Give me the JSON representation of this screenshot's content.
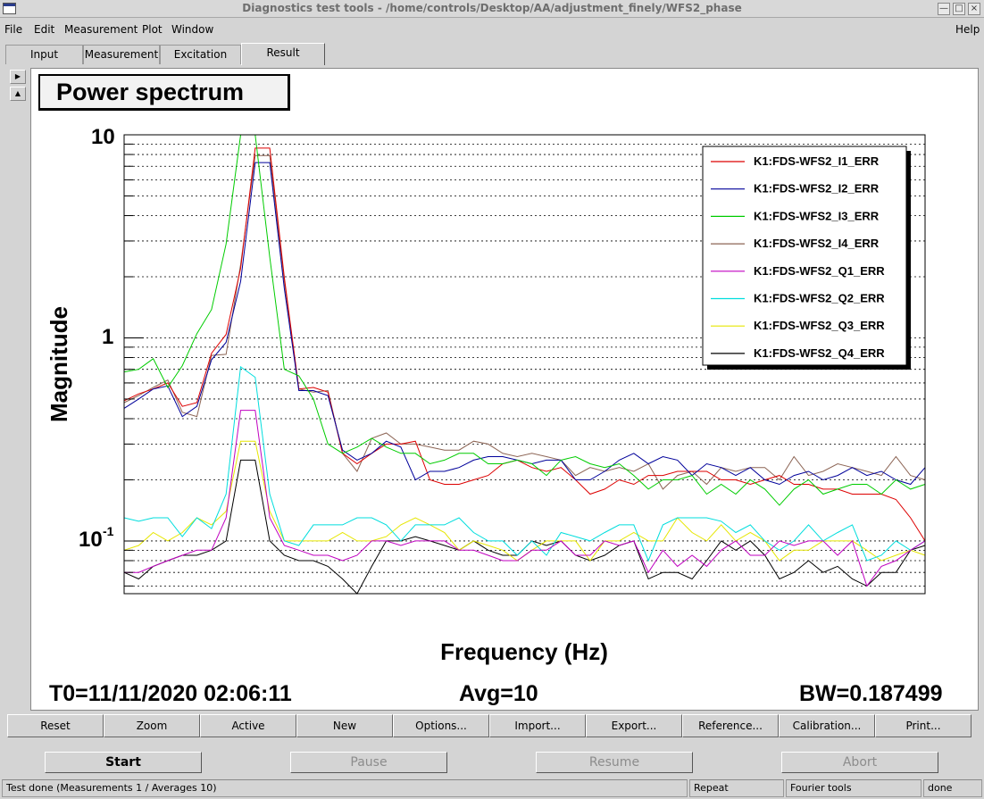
{
  "window": {
    "title": "Diagnostics test tools - /home/controls/Desktop/AA/adjustment_finely/WFS2_phase"
  },
  "menu": {
    "file": "File",
    "edit": "Edit",
    "measurement": "Measurement",
    "plot": "Plot",
    "window": "Window",
    "help": "Help"
  },
  "tabs": {
    "input": "Input",
    "measurement": "Measurement",
    "excitation": "Excitation",
    "result": "Result"
  },
  "plot": {
    "title": "Power spectrum",
    "footer": {
      "t0": "T0=11/11/2020 02:06:11",
      "avg": "Avg=10",
      "bw": "BW=0.187499"
    }
  },
  "chart_data": {
    "type": "line",
    "title": "Power spectrum",
    "xlabel": "Frequency (Hz)",
    "ylabel": "Magnitude",
    "yscale": "log",
    "ylim": [
      0.055,
      10
    ],
    "ytick_labels": {
      "top": "10",
      "mid": "1",
      "exp_base": "10",
      "exp_sup": "-1"
    },
    "grid": true,
    "legend_position": "top-right",
    "colors": {
      "I1": "#dd0000",
      "I2": "#00009a",
      "I3": "#00cc00",
      "I4": "#8c6454",
      "Q1": "#c000c0",
      "Q2": "#00dddd",
      "Q3": "#e6e600",
      "Q4": "#000000"
    },
    "series": [
      {
        "key": "I1",
        "name": "K1:FDS-WFS2_I1_ERR",
        "values": [
          0.49,
          0.53,
          0.56,
          0.6,
          0.46,
          0.48,
          0.84,
          1.04,
          2.2,
          8.6,
          8.6,
          1.99,
          0.56,
          0.57,
          0.54,
          0.27,
          0.24,
          0.27,
          0.3,
          0.3,
          0.31,
          0.2,
          0.19,
          0.19,
          0.2,
          0.21,
          0.24,
          0.25,
          0.23,
          0.22,
          0.23,
          0.2,
          0.17,
          0.18,
          0.2,
          0.19,
          0.21,
          0.21,
          0.22,
          0.22,
          0.22,
          0.2,
          0.2,
          0.19,
          0.2,
          0.21,
          0.19,
          0.19,
          0.18,
          0.18,
          0.17,
          0.17,
          0.17,
          0.16,
          0.13,
          0.1
        ]
      },
      {
        "key": "I2",
        "name": "K1:FDS-WFS2_I2_ERR",
        "values": [
          0.45,
          0.5,
          0.56,
          0.58,
          0.41,
          0.46,
          0.78,
          0.95,
          1.9,
          7.3,
          7.3,
          1.75,
          0.55,
          0.55,
          0.52,
          0.28,
          0.25,
          0.27,
          0.31,
          0.29,
          0.2,
          0.22,
          0.22,
          0.23,
          0.25,
          0.26,
          0.26,
          0.25,
          0.24,
          0.25,
          0.25,
          0.2,
          0.2,
          0.22,
          0.25,
          0.27,
          0.24,
          0.26,
          0.25,
          0.21,
          0.24,
          0.23,
          0.21,
          0.23,
          0.2,
          0.19,
          0.21,
          0.22,
          0.2,
          0.21,
          0.23,
          0.21,
          0.22,
          0.2,
          0.19,
          0.23
        ]
      },
      {
        "key": "I3",
        "name": "K1:FDS-WFS2_I3_ERR",
        "values": [
          0.68,
          0.7,
          0.79,
          0.57,
          0.73,
          1.05,
          1.38,
          2.9,
          10,
          10,
          2.5,
          0.7,
          0.65,
          0.5,
          0.3,
          0.27,
          0.29,
          0.32,
          0.29,
          0.27,
          0.27,
          0.24,
          0.25,
          0.27,
          0.27,
          0.24,
          0.24,
          0.25,
          0.24,
          0.21,
          0.25,
          0.26,
          0.24,
          0.23,
          0.24,
          0.21,
          0.18,
          0.2,
          0.2,
          0.21,
          0.17,
          0.19,
          0.17,
          0.2,
          0.18,
          0.15,
          0.18,
          0.2,
          0.17,
          0.18,
          0.19,
          0.19,
          0.17,
          0.2,
          0.18,
          0.19
        ]
      },
      {
        "key": "I4",
        "name": "K1:FDS-WFS2_I4_ERR",
        "values": [
          0.48,
          0.52,
          0.57,
          0.62,
          0.43,
          0.41,
          0.82,
          0.83,
          2.3,
          7.9,
          7.9,
          1.9,
          0.56,
          0.54,
          0.55,
          0.27,
          0.22,
          0.32,
          0.34,
          0.3,
          0.3,
          0.29,
          0.28,
          0.28,
          0.31,
          0.3,
          0.27,
          0.26,
          0.27,
          0.26,
          0.25,
          0.21,
          0.23,
          0.22,
          0.23,
          0.22,
          0.24,
          0.18,
          0.21,
          0.22,
          0.19,
          0.23,
          0.22,
          0.23,
          0.23,
          0.2,
          0.26,
          0.21,
          0.22,
          0.24,
          0.23,
          0.22,
          0.21,
          0.26,
          0.21,
          0.2
        ]
      },
      {
        "key": "Q1",
        "name": "K1:FDS-WFS2_Q1_ERR",
        "values": [
          0.07,
          0.07,
          0.075,
          0.08,
          0.085,
          0.09,
          0.09,
          0.13,
          0.44,
          0.44,
          0.13,
          0.095,
          0.09,
          0.085,
          0.085,
          0.08,
          0.085,
          0.1,
          0.1,
          0.095,
          0.1,
          0.1,
          0.1,
          0.09,
          0.09,
          0.085,
          0.08,
          0.08,
          0.09,
          0.09,
          0.1,
          0.085,
          0.085,
          0.1,
          0.095,
          0.1,
          0.07,
          0.09,
          0.075,
          0.085,
          0.075,
          0.09,
          0.1,
          0.085,
          0.085,
          0.1,
          0.095,
          0.1,
          0.1,
          0.085,
          0.1,
          0.06,
          0.075,
          0.08,
          0.09,
          0.1
        ]
      },
      {
        "key": "Q2",
        "name": "K1:FDS-WFS2_Q2_ERR",
        "values": [
          0.13,
          0.125,
          0.13,
          0.13,
          0.105,
          0.13,
          0.115,
          0.17,
          0.72,
          0.64,
          0.17,
          0.1,
          0.095,
          0.12,
          0.12,
          0.12,
          0.13,
          0.13,
          0.12,
          0.1,
          0.12,
          0.12,
          0.12,
          0.13,
          0.11,
          0.1,
          0.1,
          0.085,
          0.1,
          0.085,
          0.11,
          0.105,
          0.1,
          0.11,
          0.12,
          0.12,
          0.08,
          0.12,
          0.13,
          0.13,
          0.13,
          0.125,
          0.11,
          0.12,
          0.1,
          0.09,
          0.1,
          0.12,
          0.1,
          0.11,
          0.12,
          0.08,
          0.085,
          0.1,
          0.09,
          0.1
        ]
      },
      {
        "key": "Q3",
        "name": "K1:FDS-WFS2_Q3_ERR",
        "values": [
          0.09,
          0.095,
          0.11,
          0.1,
          0.11,
          0.13,
          0.12,
          0.14,
          0.31,
          0.31,
          0.14,
          0.1,
          0.1,
          0.1,
          0.1,
          0.11,
          0.1,
          0.1,
          0.105,
          0.12,
          0.13,
          0.12,
          0.11,
          0.09,
          0.1,
          0.095,
          0.09,
          0.08,
          0.09,
          0.1,
          0.1,
          0.1,
          0.08,
          0.1,
          0.1,
          0.11,
          0.1,
          0.1,
          0.13,
          0.11,
          0.1,
          0.12,
          0.1,
          0.11,
          0.1,
          0.08,
          0.09,
          0.09,
          0.1,
          0.1,
          0.1,
          0.09,
          0.08,
          0.085,
          0.09,
          0.085
        ]
      },
      {
        "key": "Q4",
        "name": "K1:FDS-WFS2_Q4_ERR",
        "values": [
          0.07,
          0.065,
          0.075,
          0.08,
          0.085,
          0.085,
          0.09,
          0.1,
          0.25,
          0.25,
          0.1,
          0.085,
          0.08,
          0.08,
          0.075,
          0.065,
          0.055,
          0.075,
          0.1,
          0.1,
          0.105,
          0.1,
          0.095,
          0.09,
          0.1,
          0.09,
          0.085,
          0.085,
          0.1,
          0.095,
          0.1,
          0.085,
          0.08,
          0.085,
          0.095,
          0.1,
          0.065,
          0.07,
          0.07,
          0.065,
          0.08,
          0.1,
          0.09,
          0.1,
          0.085,
          0.065,
          0.07,
          0.08,
          0.07,
          0.075,
          0.065,
          0.06,
          0.07,
          0.07,
          0.09,
          0.095
        ]
      }
    ]
  },
  "buttons": {
    "reset": "Reset",
    "zoom": "Zoom",
    "active": "Active",
    "new": "New",
    "options": "Options...",
    "import": "Import...",
    "export": "Export...",
    "reference": "Reference...",
    "calibration": "Calibration...",
    "print": "Print..."
  },
  "controls": {
    "start": "Start",
    "pause": "Pause",
    "resume": "Resume",
    "abort": "Abort"
  },
  "status": {
    "message": "Test done (Measurements 1 / Averages 10)",
    "mode": "Repeat",
    "tool": "Fourier tools",
    "state": "done"
  }
}
